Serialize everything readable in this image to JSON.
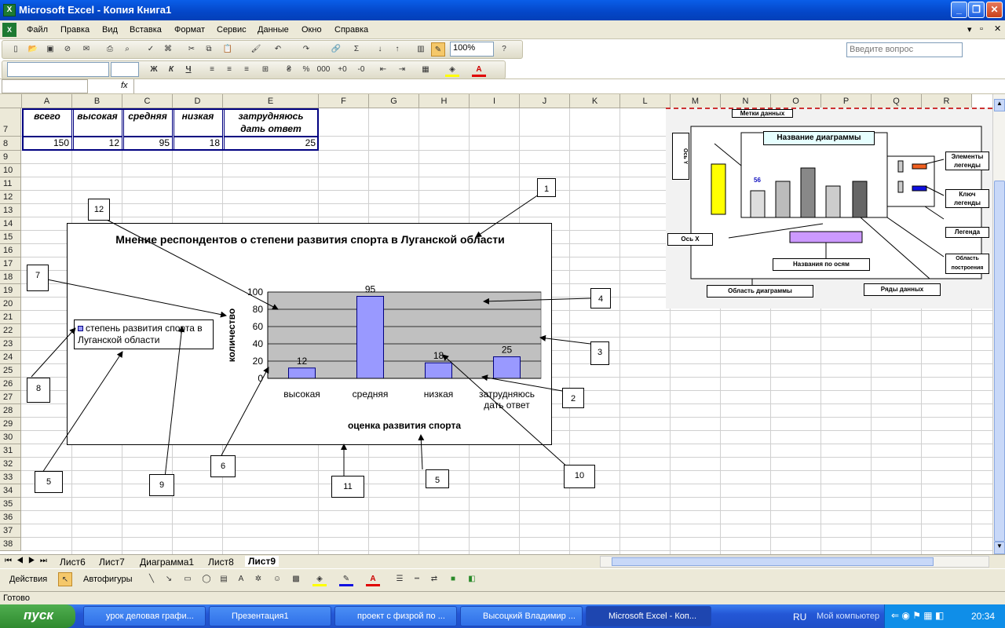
{
  "window": {
    "title": "Microsoft Excel - Копия Книга1"
  },
  "menu": {
    "items": [
      "Файл",
      "Правка",
      "Вид",
      "Вставка",
      "Формат",
      "Сервис",
      "Данные",
      "Окно",
      "Справка"
    ],
    "help_placeholder": "Введите вопрос"
  },
  "toolbar": {
    "zoom": "100%",
    "bold": "Ж",
    "italic": "К",
    "underline": "Ч"
  },
  "formula": {
    "fx": "fx"
  },
  "columns": [
    "A",
    "B",
    "C",
    "D",
    "E",
    "F",
    "G",
    "H",
    "I",
    "J",
    "K",
    "L",
    "M",
    "N",
    "O",
    "P",
    "Q",
    "R"
  ],
  "rows": [
    "7",
    "8",
    "9",
    "10",
    "11",
    "12",
    "13",
    "14",
    "15",
    "16",
    "17",
    "18",
    "19",
    "20",
    "21",
    "22",
    "23",
    "24",
    "25",
    "26",
    "27",
    "28",
    "29",
    "30",
    "31",
    "32",
    "33",
    "34",
    "35",
    "36",
    "37",
    "38"
  ],
  "table": {
    "headers": [
      "всего",
      "высокая",
      "средняя",
      "низкая",
      "затрудняюсь дать ответ"
    ],
    "values": [
      "150",
      "12",
      "95",
      "18",
      "25"
    ]
  },
  "chart_data": {
    "type": "bar",
    "title": "Мнение респондентов о степени развития спорта в Луганской области",
    "categories": [
      "высокая",
      "средняя",
      "низкая",
      "затрудняюсь дать ответ"
    ],
    "values": [
      12,
      95,
      18,
      25
    ],
    "data_labels": [
      "12",
      "95",
      "18",
      "25"
    ],
    "ylabel": "количество",
    "xlabel": "оценка развития спорта",
    "ylim": [
      0,
      100
    ],
    "yticks": [
      "0",
      "20",
      "40",
      "60",
      "80",
      "100"
    ],
    "legend": "степень развития спорта в Луганской области",
    "bar_color": "#9999ff",
    "plot_color": "#c0c0c0"
  },
  "callouts": [
    "1",
    "2",
    "3",
    "4",
    "5",
    "5",
    "6",
    "7",
    "8",
    "9",
    "10",
    "11",
    "12"
  ],
  "reference": {
    "title": "Название диаграммы",
    "axis_y": "Ось Y",
    "axis_x": "Ось Х",
    "data_labels": "Метки данных",
    "data_label_value": "56",
    "legend_elements": "Элементы легенды",
    "legend_key": "Ключ легенды",
    "legend": "Легенда",
    "axis_names": "Названия по осям",
    "plot_area": "Область построения",
    "chart_area": "Область диаграммы",
    "series": "Ряды данных"
  },
  "sheets": [
    "Лист6",
    "Лист7",
    "Диаграмма1",
    "Лист8",
    "Лист9"
  ],
  "drawing": {
    "actions": "Действия",
    "autoshapes": "Автофигуры"
  },
  "status": {
    "text": "Готово"
  },
  "taskbar": {
    "start": "пуск",
    "tasks": [
      "урок деловая графи...",
      "Презентация1",
      "проект с физрой по ...",
      "Высоцкий Владимир ...",
      "Microsoft Excel - Коп..."
    ],
    "lang": "RU",
    "mycomputer": "Мой компьютер",
    "clock": "20:34"
  }
}
